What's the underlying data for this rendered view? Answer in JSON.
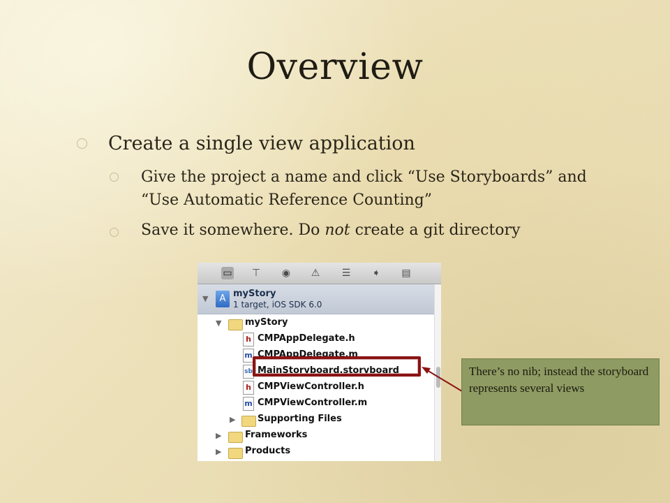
{
  "slide": {
    "title": "Overview",
    "bullets": {
      "b1": "Create a single view application",
      "b2": "Give the project a name and click “Use Storyboards” and “Use Automatic Reference Counting”",
      "b3_pre": "Save it somewhere.  Do ",
      "b3_em": "not",
      "b3_post": " create a git directory"
    },
    "callout": "There’s no nib; instead the storyboard represents several views"
  },
  "navigator": {
    "toolbar_icons": [
      "folder-icon",
      "hierarchy-icon",
      "search-icon",
      "warning-icon",
      "list-icon",
      "breakpoint-icon",
      "log-icon"
    ],
    "project": {
      "name": "myStory",
      "subtitle": "1 target, iOS SDK 6.0"
    },
    "items": [
      {
        "label": "myStory",
        "kind": "folder"
      },
      {
        "label": "CMPAppDelegate.h",
        "kind": "h",
        "glyph": "h"
      },
      {
        "label": "CMPAppDelegate.m",
        "kind": "m",
        "glyph": "m"
      },
      {
        "label": "MainStoryboard.storyboard",
        "kind": "sb",
        "glyph": "sb"
      },
      {
        "label": "CMPViewController.h",
        "kind": "h",
        "glyph": "h"
      },
      {
        "label": "CMPViewController.m",
        "kind": "m",
        "glyph": "m"
      },
      {
        "label": "Supporting Files",
        "kind": "folder"
      },
      {
        "label": "Frameworks",
        "kind": "folder"
      },
      {
        "label": "Products",
        "kind": "folder"
      }
    ]
  },
  "colors": {
    "highlight": "#8b1414",
    "callout_bg": "#8e9b62"
  }
}
